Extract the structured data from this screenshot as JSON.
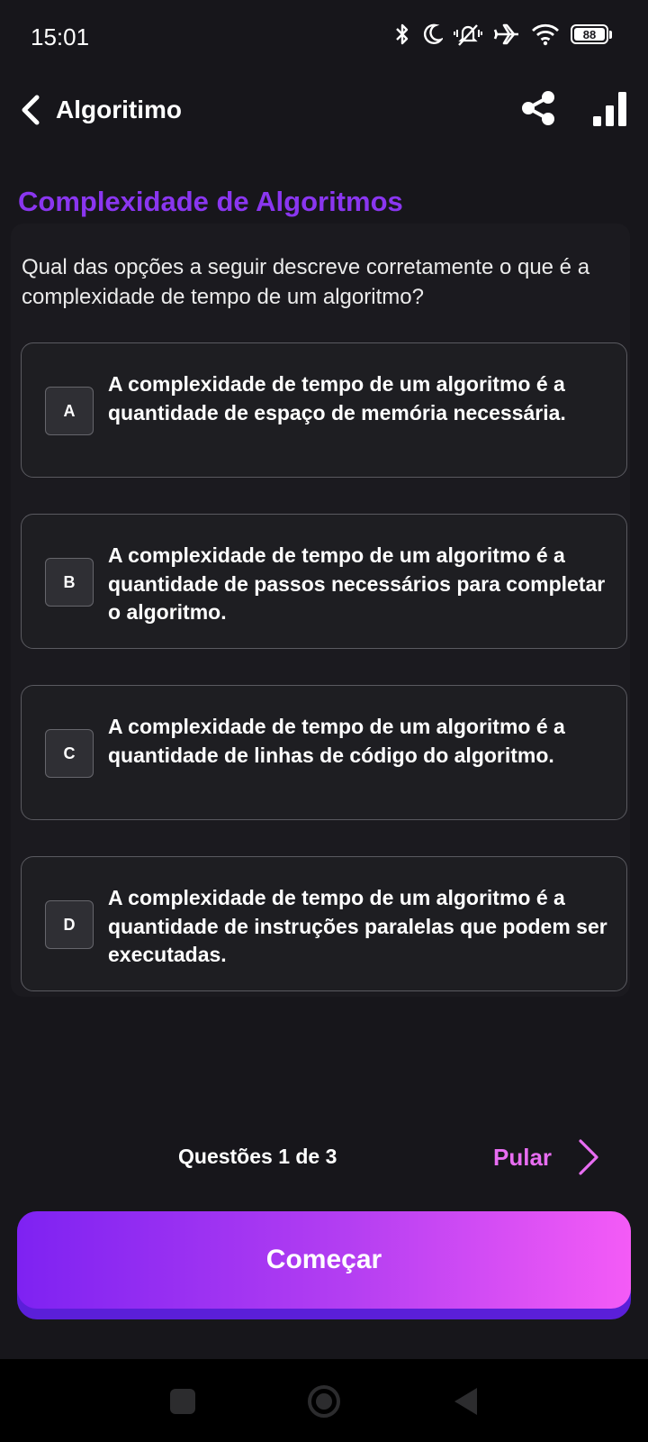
{
  "status_bar": {
    "time": "15:01",
    "battery_level": "88",
    "icons": [
      "bluetooth-icon",
      "moon-icon",
      "mute-vibrate-icon",
      "airplane-icon",
      "wifi-icon",
      "battery-icon"
    ]
  },
  "header": {
    "title": "Algoritimo",
    "back_icon": "chevron-left-icon",
    "share_icon": "share-icon",
    "stats_icon": "bar-chart-icon"
  },
  "quiz": {
    "topic": "Complexidade de Algoritmos",
    "question": "Qual das opções a seguir descreve corretamente o que é a complexidade de tempo de um algoritmo?",
    "options": [
      {
        "letter": "A",
        "text": "A complexidade de tempo de um algoritmo é a quantidade de espaço de memória necessária."
      },
      {
        "letter": "B",
        "text": "A complexidade de tempo de um algoritmo é a quantidade de passos necessários para completar o algoritmo."
      },
      {
        "letter": "C",
        "text": "A complexidade de tempo de um algoritmo é a quantidade de linhas de código do algoritmo."
      },
      {
        "letter": "D",
        "text": "A complexidade de tempo de um algoritmo é a quantidade de instruções paralelas que podem ser executadas."
      }
    ]
  },
  "footer": {
    "progress": "Questões 1 de 3",
    "skip_label": "Pular",
    "start_label": "Começar"
  },
  "colors": {
    "background": "#17161b",
    "accent_purple": "#8a36f0",
    "skip_pink": "#e86df2",
    "gradient_start": "#7e22f2",
    "gradient_end": "#f45bf6"
  }
}
